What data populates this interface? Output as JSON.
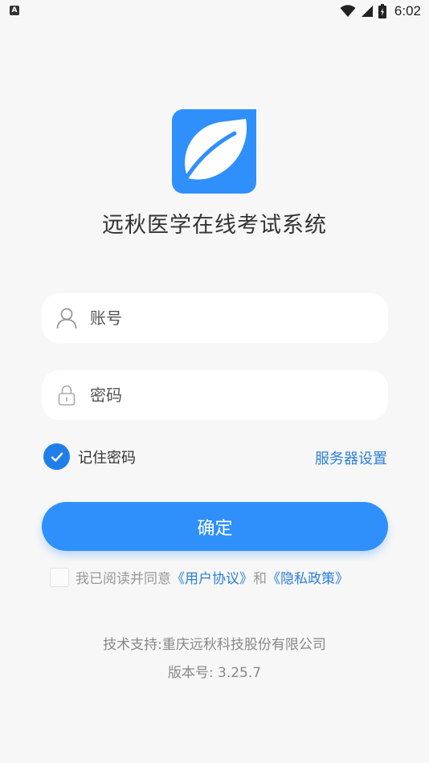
{
  "status_bar": {
    "indicator": "A",
    "time": "6:02",
    "icons": [
      "wifi-icon",
      "signal-icon",
      "battery-icon"
    ]
  },
  "app": {
    "title": "远秋医学在线考试系统",
    "logo_icon": "leaf-icon",
    "brand_color": "#2f90fb"
  },
  "login": {
    "account_placeholder": "账号",
    "account_value": "",
    "account_icon": "user-icon",
    "password_placeholder": "密码",
    "password_value": "",
    "password_icon": "lock-icon",
    "remember_label": "记住密码",
    "remember_checked": true,
    "server_settings_label": "服务器设置",
    "confirm_label": "确定"
  },
  "agreement": {
    "checked": false,
    "prefix": "我已阅读并同意",
    "user_agreement": "《用户协议》",
    "and": "和",
    "privacy_policy": "《隐私政策》"
  },
  "footer": {
    "support": "技术支持:重庆远秋科技股份有限公司",
    "version": "版本号: 3.25.7"
  }
}
